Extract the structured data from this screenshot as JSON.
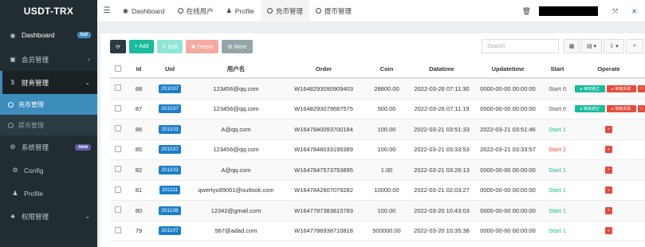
{
  "app": {
    "brand": "USDT-TRX"
  },
  "sidebar": {
    "dashboard": {
      "label": "Dashboard",
      "badge": "hot"
    },
    "member": {
      "label": "会员管理"
    },
    "finance": {
      "label": "财务管理"
    },
    "finance_sub": [
      {
        "label": "充币管理"
      },
      {
        "label": "提币管理"
      }
    ],
    "system": {
      "label": "系统管理",
      "badge": "new"
    },
    "system_sub": [
      {
        "label": "Config"
      },
      {
        "label": "Profile"
      }
    ],
    "permission": {
      "label": "权限管理"
    }
  },
  "topbar": {
    "tabs": [
      {
        "label": "Dashboard"
      },
      {
        "label": "在线用户"
      },
      {
        "label": "Profile"
      },
      {
        "label": "充币管理"
      },
      {
        "label": "提币管理"
      }
    ]
  },
  "toolbar": {
    "refresh_label": "",
    "add_label": "+ Add",
    "edit_label": "✎ Edit",
    "delete_label": "✖ Delete",
    "more_label": "⚙ More",
    "search_placeholder": "Search"
  },
  "table": {
    "headers": [
      "Id",
      "Uid",
      "用户名",
      "Order",
      "Coin",
      "Datatime",
      "Updatetime",
      "Start",
      "Operate"
    ],
    "pass_label": "▸ 审核通过",
    "fail_label": "▸ 审核失败",
    "rows": [
      {
        "id": "88",
        "uid": "201037",
        "user": "123456@qq.com",
        "order": "W1648293090909403",
        "coin": "28800.00",
        "datatime": "2022-03-26 07:11:30",
        "updatetime": "0000-00-00 00:00:00",
        "start": "Start 0",
        "start_color": "gray",
        "review": true
      },
      {
        "id": "87",
        "uid": "201037",
        "user": "123456@qq.com",
        "order": "W1648293079687575",
        "coin": "500.00",
        "datatime": "2022-03-26 07:11:19",
        "updatetime": "0000-00-00 00:00:00",
        "start": "Start 0",
        "start_color": "gray",
        "review": true
      },
      {
        "id": "86",
        "uid": "201103",
        "user": "A@qq.com",
        "order": "W1647840093700184",
        "coin": "100.00",
        "datatime": "2022-03-21 03:51:33",
        "updatetime": "2022-03-21 03:51:46",
        "start": "Start 1",
        "start_color": "green",
        "review": false
      },
      {
        "id": "85",
        "uid": "201037",
        "user": "123456@qq.com",
        "order": "W1647848033195389",
        "coin": "100.00",
        "datatime": "2022-03-21 03:33:53",
        "updatetime": "2022-03-21 03:33:57",
        "start": "Start 2",
        "start_color": "red",
        "review": false
      },
      {
        "id": "82",
        "uid": "201103",
        "user": "A@qq.com",
        "order": "W1647847573793895",
        "coin": "1.00",
        "datatime": "2022-03-21 03:26:13",
        "updatetime": "0000-00-00 00:00:00",
        "start": "Start 1",
        "start_color": "green",
        "review": false
      },
      {
        "id": "81",
        "uid": "201111",
        "user": "qwertyu99061@outlook.com",
        "order": "W1647842607079282",
        "coin": "10000.00",
        "datatime": "2022-03-21 02:03:27",
        "updatetime": "0000-00-00 00:00:00",
        "start": "Start 1",
        "start_color": "green",
        "review": false
      },
      {
        "id": "80",
        "uid": "201108",
        "user": "12342@gmail.com",
        "order": "W1647787383815783",
        "coin": "100.00",
        "datatime": "2022-03-20 10:43:03",
        "updatetime": "0000-00-00 00:00:00",
        "start": "Start 1",
        "start_color": "green",
        "review": false
      },
      {
        "id": "79",
        "uid": "201107",
        "user": "567@adad.com",
        "order": "W1647786938710818",
        "coin": "500000.00",
        "datatime": "2022-03-20 10:35:38",
        "updatetime": "0000-00-00 00:00:00",
        "start": "Start 1",
        "start_color": "green",
        "review": false
      }
    ]
  }
}
